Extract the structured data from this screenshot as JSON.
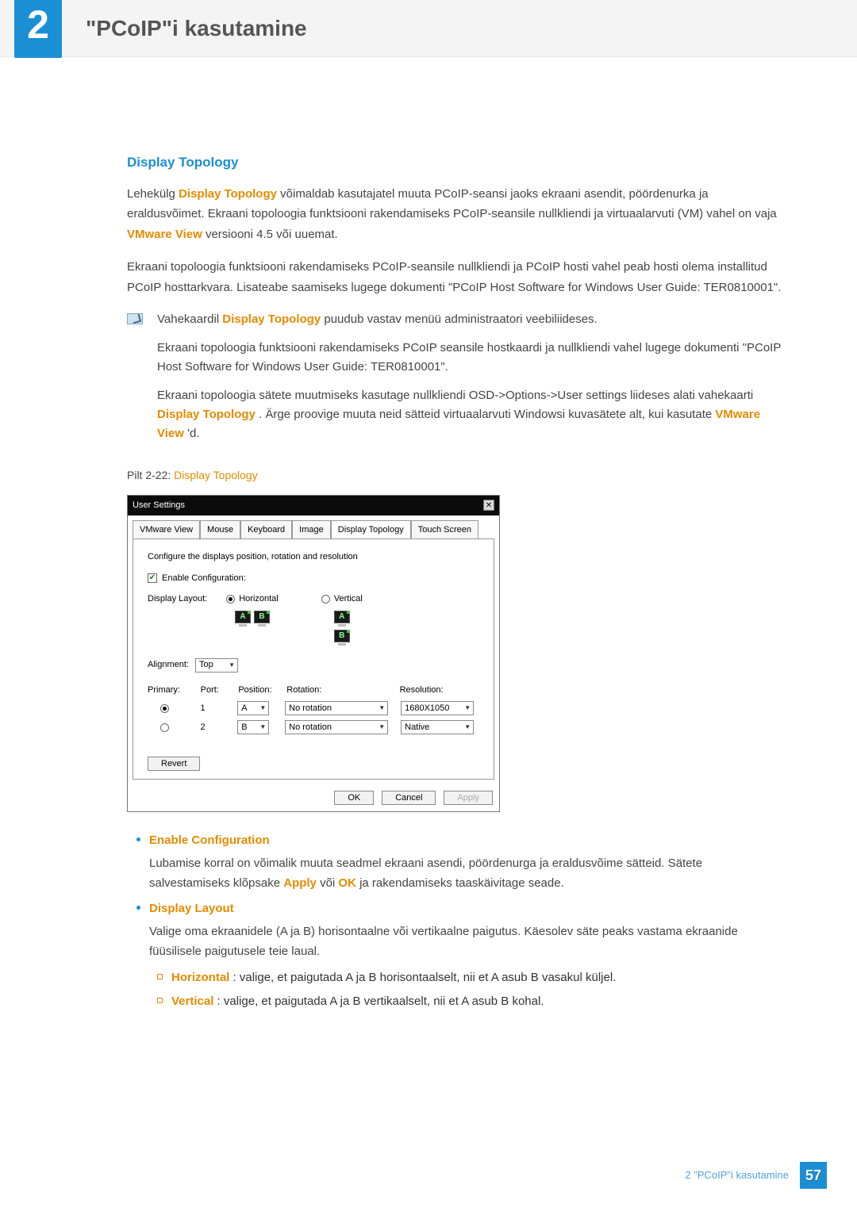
{
  "chapter": {
    "number": "2",
    "title": "\"PCoIP\"i kasutamine"
  },
  "section": {
    "heading": "Display Topology",
    "p1_a": "Lehekülg ",
    "p1_hl1": "Display Topology",
    "p1_b": " võimaldab kasutajatel muuta PCoIP-seansi jaoks ekraani asendit, pöördenurka ja eraldusvõimet. Ekraani topoloogia funktsiooni rakendamiseks PCoIP-seansile nullkliendi ja virtuaalarvuti (VM) vahel on vaja ",
    "p1_hl2": "VMware View",
    "p1_c": " versiooni 4.5 või uuemat.",
    "p2": "Ekraani topoloogia funktsiooni rakendamiseks PCoIP-seansile nullkliendi ja PCoIP hosti vahel peab hosti olema installitud PCoIP hosttarkvara. Lisateabe saamiseks lugege dokumenti \"PCoIP Host Software for Windows User Guide: TER0810001\"."
  },
  "note": {
    "np1_a": "Vahekaardil ",
    "np1_hl": "Display Topology",
    "np1_b": " puudub vastav menüü administraatori veebiliideses.",
    "np2": "Ekraani topoloogia funktsiooni rakendamiseks PCoIP seansile hostkaardi ja nullkliendi vahel lugege dokumenti \"PCoIP Host Software for Windows User Guide: TER0810001\".",
    "np3_a": "Ekraani topoloogia sätete muutmiseks kasutage nullkliendi OSD->Options->User settings liideses alati vahekaarti ",
    "np3_hl1": "Display Topology",
    "np3_b": ". Ärge proovige muuta neid sätteid virtuaalarvuti Windowsi kuvasätete alt, kui kasutate ",
    "np3_hl2": "VMware View",
    "np3_c": "'d."
  },
  "figure": {
    "prefix": "Pilt 2-22: ",
    "name": "Display Topology"
  },
  "dialog": {
    "title": "User Settings",
    "tabs": [
      "VMware View",
      "Mouse",
      "Keyboard",
      "Image",
      "Display Topology",
      "Touch Screen"
    ],
    "instruction": "Configure the displays position, rotation and resolution",
    "enable_label": "Enable Configuration:",
    "layout_label": "Display Layout:",
    "layout_h": "Horizontal",
    "layout_v": "Vertical",
    "monA": "A",
    "monB": "B",
    "align_label": "Alignment:",
    "align_value": "Top",
    "th_primary": "Primary:",
    "th_port": "Port:",
    "th_pos": "Position:",
    "th_rot": "Rotation:",
    "th_res": "Resolution:",
    "rows": [
      {
        "port": "1",
        "pos": "A",
        "rot": "No rotation",
        "res": "1680X1050",
        "selected": true
      },
      {
        "port": "2",
        "pos": "B",
        "rot": "No rotation",
        "res": "Native",
        "selected": false
      }
    ],
    "revert": "Revert",
    "ok": "OK",
    "cancel": "Cancel",
    "apply": "Apply"
  },
  "bullets": {
    "b1_title": "Enable Configuration",
    "b1_body_a": "Lubamise korral on võimalik muuta seadmel ekraani asendi, pöördenurga ja eraldusvõime sätteid. Sätete salvestamiseks klõpsake ",
    "b1_hl1": "Apply",
    "b1_mid": " või ",
    "b1_hl2": "OK",
    "b1_body_b": " ja rakendamiseks taaskäivitage seade.",
    "b2_title": "Display Layout",
    "b2_body": "Valige oma ekraanidele (A ja B) horisontaalne või vertikaalne paigutus. Käesolev säte peaks vastama ekraanide füüsilisele paigutusele teie laual.",
    "sub1_hl": "Horizontal",
    "sub1_txt": ": valige, et paigutada A ja B horisontaalselt, nii et A asub B vasakul küljel.",
    "sub2_hl": "Vertical",
    "sub2_txt": ": valige, et paigutada A ja B vertikaalselt, nii et A asub B kohal."
  },
  "footer": {
    "text": "2 \"PCoIP\"i kasutamine",
    "page": "57"
  }
}
